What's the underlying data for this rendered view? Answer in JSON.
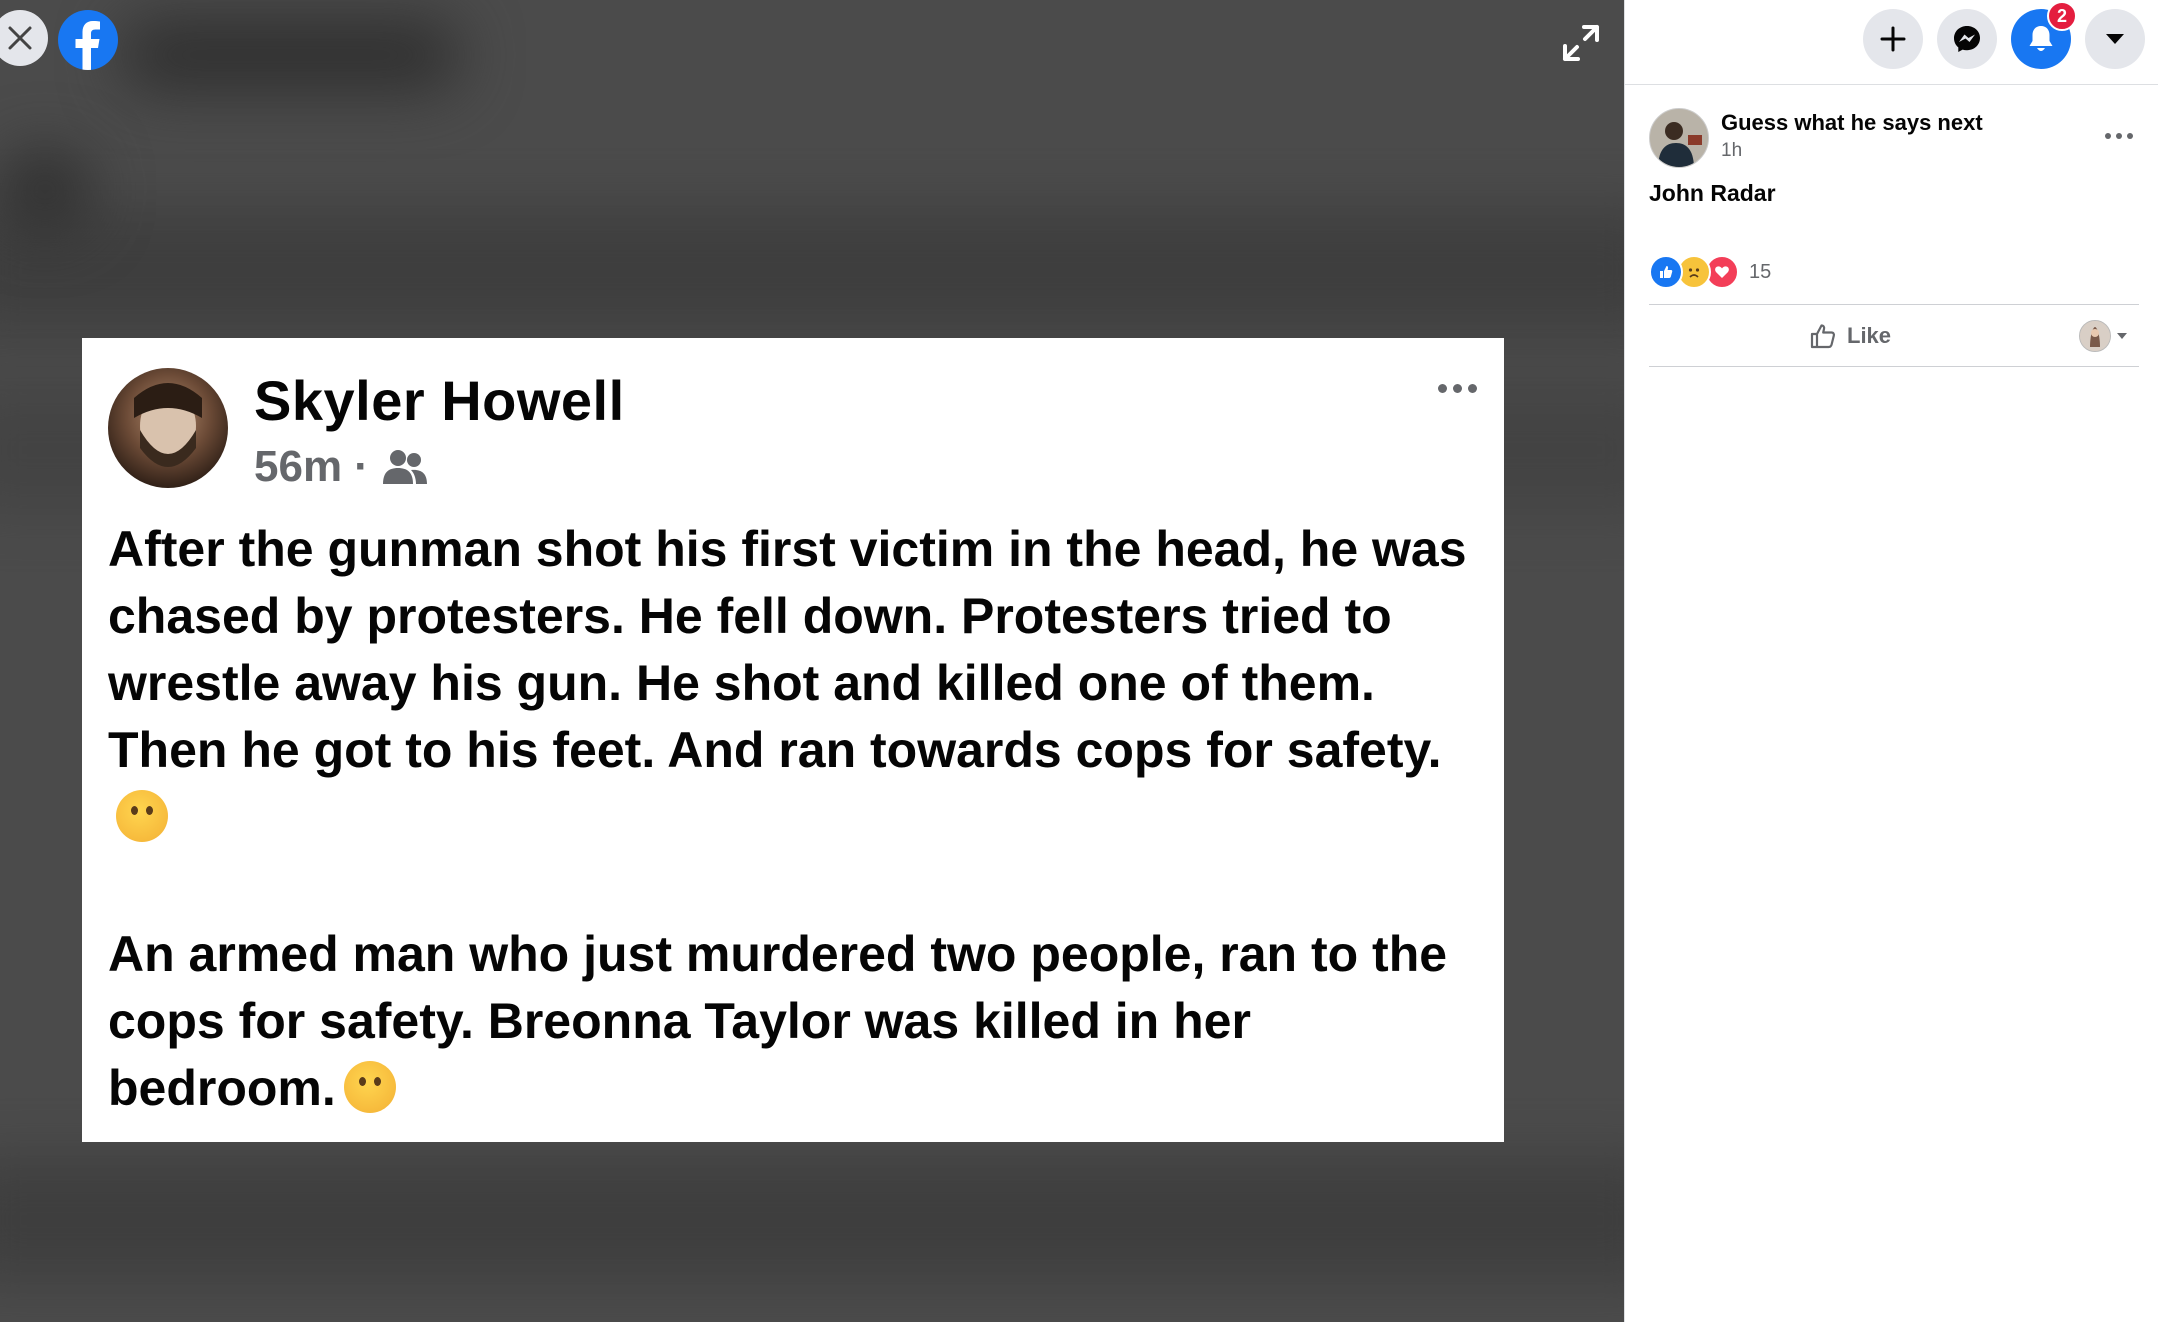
{
  "viewer": {
    "close_icon": "close-icon",
    "logo_icon": "facebook-logo",
    "expand_icon": "expand-icon"
  },
  "shared_image": {
    "author": "Skyler Howell",
    "time": "56m",
    "separator": "·",
    "audience_icon": "friends-icon",
    "paragraphs": [
      "After the gunman shot his first victim in the head, he was chased by protesters. He fell down. Protesters tried to wrestle away his gun. He shot and killed one of them. Then he got to his feet. And ran towards cops for safety.",
      "An armed man who just murdered two people, ran to the cops for safety. Breonna Taylor was killed in her bedroom."
    ],
    "emoji": "thinking-face"
  },
  "topbar": {
    "buttons": [
      "create-icon",
      "messenger-icon",
      "notifications-icon",
      "account-menu-icon"
    ],
    "notification_count": "2"
  },
  "post": {
    "title": "Guess what he says next",
    "time": "1h",
    "caption": "John Radar",
    "reactions": [
      "like",
      "sad",
      "love"
    ],
    "reaction_count": "15",
    "like_label": "Like"
  },
  "colors": {
    "facebook_blue": "#1877f2",
    "badge_red": "#e41e3f",
    "viewer_bg": "#4b4b4b",
    "secondary_text": "#65676b"
  }
}
